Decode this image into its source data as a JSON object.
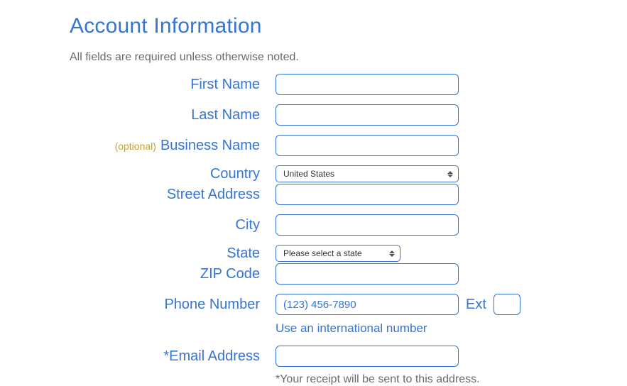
{
  "heading": "Account Information",
  "subtitle": "All fields are required unless otherwise noted.",
  "optional_tag": "(optional)",
  "labels": {
    "first_name": "First Name",
    "last_name": "Last Name",
    "business_name": "Business Name",
    "country": "Country",
    "street_address": "Street Address",
    "city": "City",
    "state": "State",
    "zip_code": "ZIP Code",
    "phone_number": "Phone Number",
    "ext": "Ext",
    "email_address": "*Email Address"
  },
  "values": {
    "first_name": "",
    "last_name": "",
    "business_name": "",
    "country": "United States",
    "street_address": "",
    "city": "",
    "state": "Please select a state",
    "zip_code": "",
    "phone_number": "",
    "phone_placeholder": "(123) 456-7890",
    "ext": "",
    "email_address": ""
  },
  "intl_link": "Use an international number",
  "email_note": "*Your receipt will be sent to this address."
}
